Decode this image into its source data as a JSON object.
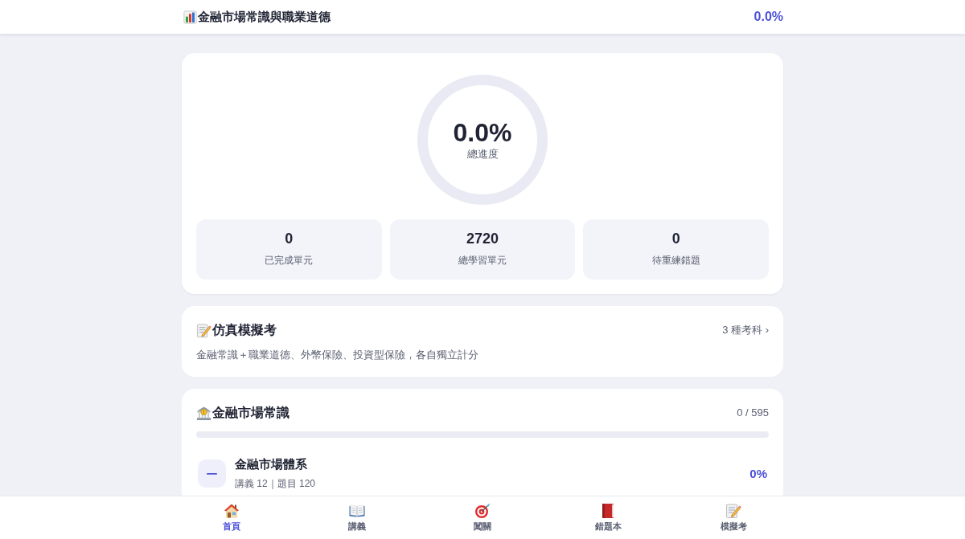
{
  "header": {
    "title": "金融市場常識與職業道德",
    "progress": "0.0%"
  },
  "overview": {
    "ring": {
      "level": 0,
      "value": "0.0%",
      "label": "總進度"
    },
    "stats": [
      {
        "value": "0",
        "label": "已完成單元"
      },
      {
        "value": "2720",
        "label": "總學習單元"
      },
      {
        "value": "0",
        "label": "待重練錯題"
      }
    ]
  },
  "mock_exam": {
    "title": "仿真模擬考",
    "link": "3 種考科 ›",
    "description": "金融常識＋職業道德、外幣保險、投資型保險，各自獨立計分"
  },
  "subjects": [
    {
      "title": "金融市場常識",
      "count": "0 / 595",
      "level": 0,
      "units": [
        {
          "title": "金融市場體系",
          "meta": "講義 12｜題目 120",
          "percent": "0%"
        }
      ]
    }
  ],
  "bottom_nav": [
    {
      "kind": "home",
      "label": "首頁",
      "selected": true
    },
    {
      "kind": "notes",
      "label": "講義",
      "selected": false
    },
    {
      "kind": "levels",
      "label": "闖關",
      "selected": false
    },
    {
      "kind": "mistakes",
      "label": "錯題本",
      "selected": false
    },
    {
      "kind": "exam",
      "label": "模擬考",
      "selected": false
    }
  ]
}
